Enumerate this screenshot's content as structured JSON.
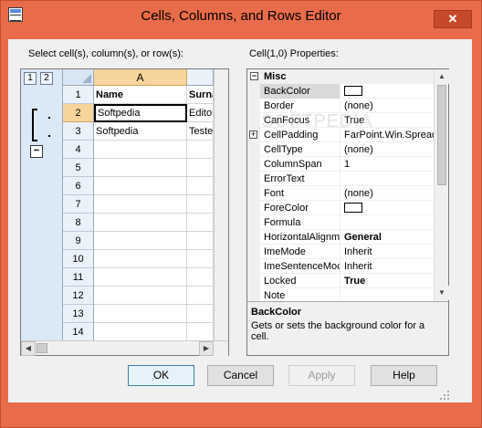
{
  "window": {
    "title": "Cells, Columns, and Rows Editor",
    "close_label": "✕"
  },
  "left": {
    "prompt": "Select cell(s), column(s), or row(s):",
    "outline_levels": [
      "1",
      "2"
    ],
    "collapse_label": "−",
    "column_headers": [
      "A",
      ""
    ],
    "row_numbers": [
      "1",
      "2",
      "3",
      "4",
      "5",
      "6",
      "7",
      "8",
      "9",
      "10",
      "11",
      "12",
      "13",
      "14"
    ],
    "selected_row": "2",
    "rows": [
      [
        "Name",
        "Surname"
      ],
      [
        "Softpedia",
        "Editor"
      ],
      [
        "Softpedia",
        "Tester"
      ]
    ]
  },
  "right": {
    "heading": "Cell(1,0) Properties:",
    "category": "Misc",
    "properties": [
      {
        "name": "BackColor",
        "value": "",
        "swatch": "#ffffff",
        "selected": true
      },
      {
        "name": "Border",
        "value": "(none)"
      },
      {
        "name": "CanFocus",
        "value": "True"
      },
      {
        "name": "CellPadding",
        "value": "FarPoint.Win.Spread",
        "expandable": true
      },
      {
        "name": "CellType",
        "value": "(none)"
      },
      {
        "name": "ColumnSpan",
        "value": "1"
      },
      {
        "name": "ErrorText",
        "value": ""
      },
      {
        "name": "Font",
        "value": "(none)"
      },
      {
        "name": "ForeColor",
        "value": "",
        "swatch": "#ffffff"
      },
      {
        "name": "Formula",
        "value": ""
      },
      {
        "name": "HorizontalAlignme",
        "value": "General",
        "bold": true
      },
      {
        "name": "ImeMode",
        "value": "Inherit"
      },
      {
        "name": "ImeSentenceMoc",
        "value": "Inherit"
      },
      {
        "name": "Locked",
        "value": "True",
        "bold": true
      },
      {
        "name": "Note",
        "value": ""
      }
    ],
    "description_title": "BackColor",
    "description_text": "Gets or sets the background color for a cell."
  },
  "buttons": {
    "ok": "OK",
    "cancel": "Cancel",
    "apply": "Apply",
    "help": "Help"
  },
  "colors": {
    "frame": "#e96c4a",
    "header_selected": "#f7d59a"
  },
  "watermark": "SOFTPEDIA"
}
